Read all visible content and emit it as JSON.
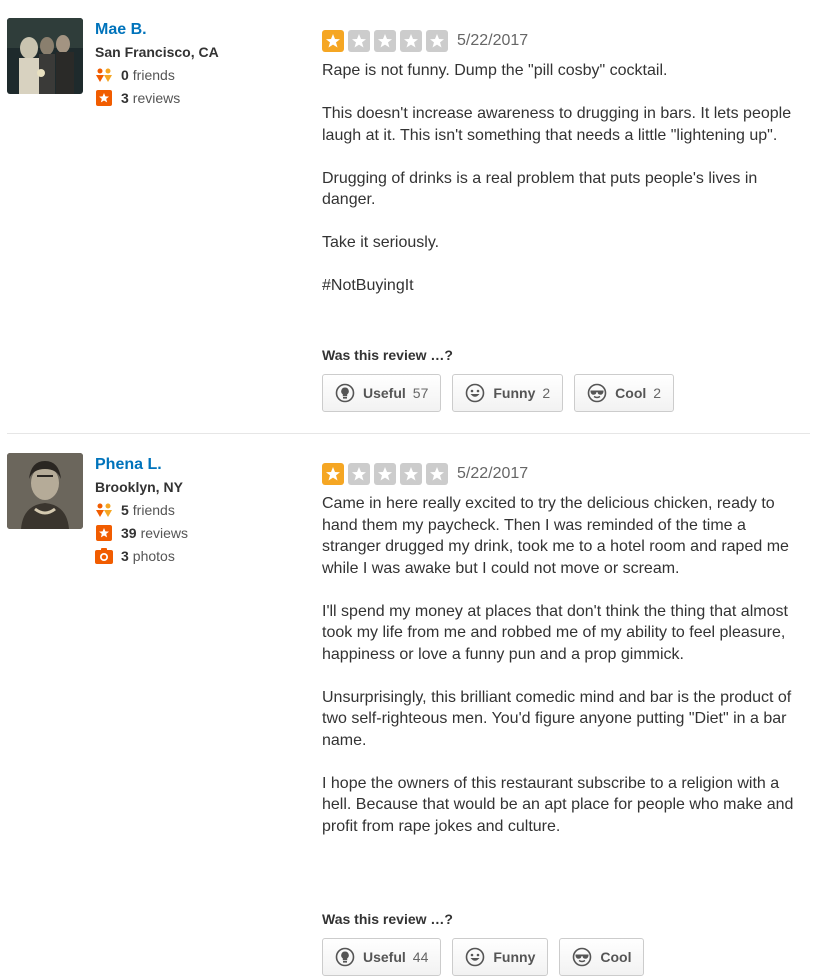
{
  "colors": {
    "link_blue": "#0073bb",
    "star_on": "#f5a623",
    "star_off": "#cccccc",
    "friends_orange": "#f15c00",
    "reviews_badge": "#f15c00"
  },
  "vote_prompt": "Was this review …?",
  "reviews": [
    {
      "user": {
        "name": "Mae B.",
        "location": "San Francisco, CA",
        "friends_count": "0",
        "friends_label": "friends",
        "reviews_count": "3",
        "reviews_label": "reviews"
      },
      "rating": 1,
      "rating_max": 5,
      "date": "5/22/2017",
      "paragraphs": [
        "Rape is not funny. Dump the \"pill cosby\" cocktail.",
        "This doesn't increase awareness to drugging in bars. It lets people laugh at it. This isn't something that needs a little \"lightening up\".",
        "Drugging of drinks is a real problem that puts people's lives in danger.",
        "Take it seriously.",
        "#NotBuyingIt"
      ],
      "votes": {
        "useful_label": "Useful",
        "useful_count": "57",
        "funny_label": "Funny",
        "funny_count": "2",
        "cool_label": "Cool",
        "cool_count": "2"
      }
    },
    {
      "user": {
        "name": "Phena L.",
        "location": "Brooklyn, NY",
        "friends_count": "5",
        "friends_label": "friends",
        "reviews_count": "39",
        "reviews_label": "reviews",
        "photos_count": "3",
        "photos_label": "photos"
      },
      "rating": 1,
      "rating_max": 5,
      "date": "5/22/2017",
      "paragraphs": [
        "Came in here really excited to try the delicious chicken, ready to hand them my paycheck. Then I was reminded of the time a stranger drugged my drink, took me to a hotel room and raped me while I was awake but I could not move or scream.",
        "I'll spend my money at places that don't think the thing that almost took my life from me and robbed me of my ability to feel pleasure, happiness or love a funny pun and a prop gimmick.",
        "Unsurprisingly, this brilliant comedic mind and bar is the product of two self-righteous men. You'd figure anyone putting \"Diet\" in a bar name.",
        "I hope the owners of this restaurant subscribe to a religion with a hell. Because that would be an apt place for people who make and profit from rape jokes and culture."
      ],
      "votes": {
        "useful_label": "Useful",
        "useful_count": "44",
        "funny_label": "Funny",
        "funny_count": "",
        "cool_label": "Cool",
        "cool_count": ""
      }
    }
  ]
}
